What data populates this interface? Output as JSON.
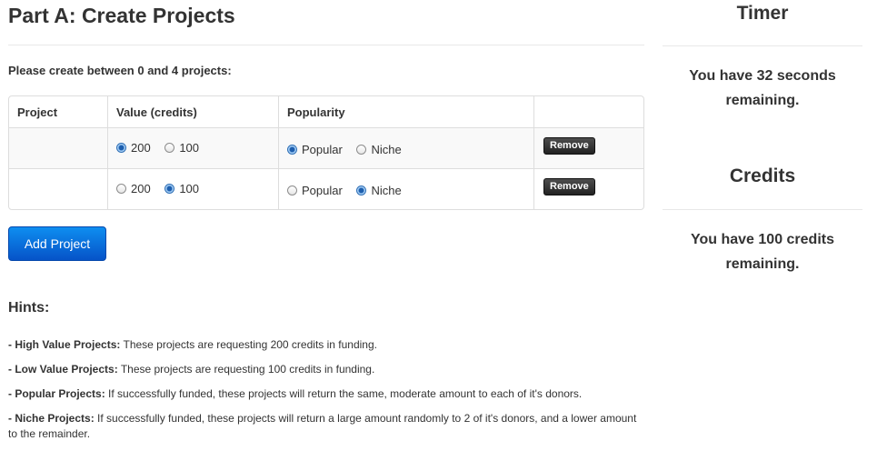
{
  "main": {
    "title": "Part A: Create Projects",
    "instructions": "Please create between 0 and 4 projects:",
    "table": {
      "headers": [
        "Project",
        "Value (credits)",
        "Popularity",
        ""
      ],
      "rows": [
        {
          "project": "",
          "value_options": [
            "200",
            "100"
          ],
          "value_selected": "200",
          "popularity_options": [
            "Popular",
            "Niche"
          ],
          "popularity_selected": "Popular",
          "remove_label": "Remove"
        },
        {
          "project": "",
          "value_options": [
            "200",
            "100"
          ],
          "value_selected": "100",
          "popularity_options": [
            "Popular",
            "Niche"
          ],
          "popularity_selected": "Niche",
          "remove_label": "Remove"
        }
      ]
    },
    "add_button_label": "Add Project",
    "hints_title": "Hints:",
    "hints": [
      {
        "term": "- High Value Projects:",
        "text": " These projects are requesting 200 credits in funding."
      },
      {
        "term": "- Low Value Projects:",
        "text": " These projects are requesting 100 credits in funding."
      },
      {
        "term": "- Popular Projects:",
        "text": " If successfully funded, these projects will return the same, moderate amount to each of it's donors."
      },
      {
        "term": "- Niche Projects:",
        "text": " If successfully funded, these projects will return a large amount randomly to 2 of it's donors, and a lower amount to the remainder."
      }
    ]
  },
  "sidebar": {
    "timer_title": "Timer",
    "timer_text_line1": "You have 32 seconds",
    "timer_text_line2": "remaining.",
    "credits_title": "Credits",
    "credits_text_line1": "You have 100 credits",
    "credits_text_line2": "remaining."
  },
  "colors": {
    "accent": "#0a6fdc",
    "remove_button": "#333333",
    "radio_checked": "#1e5fae"
  }
}
